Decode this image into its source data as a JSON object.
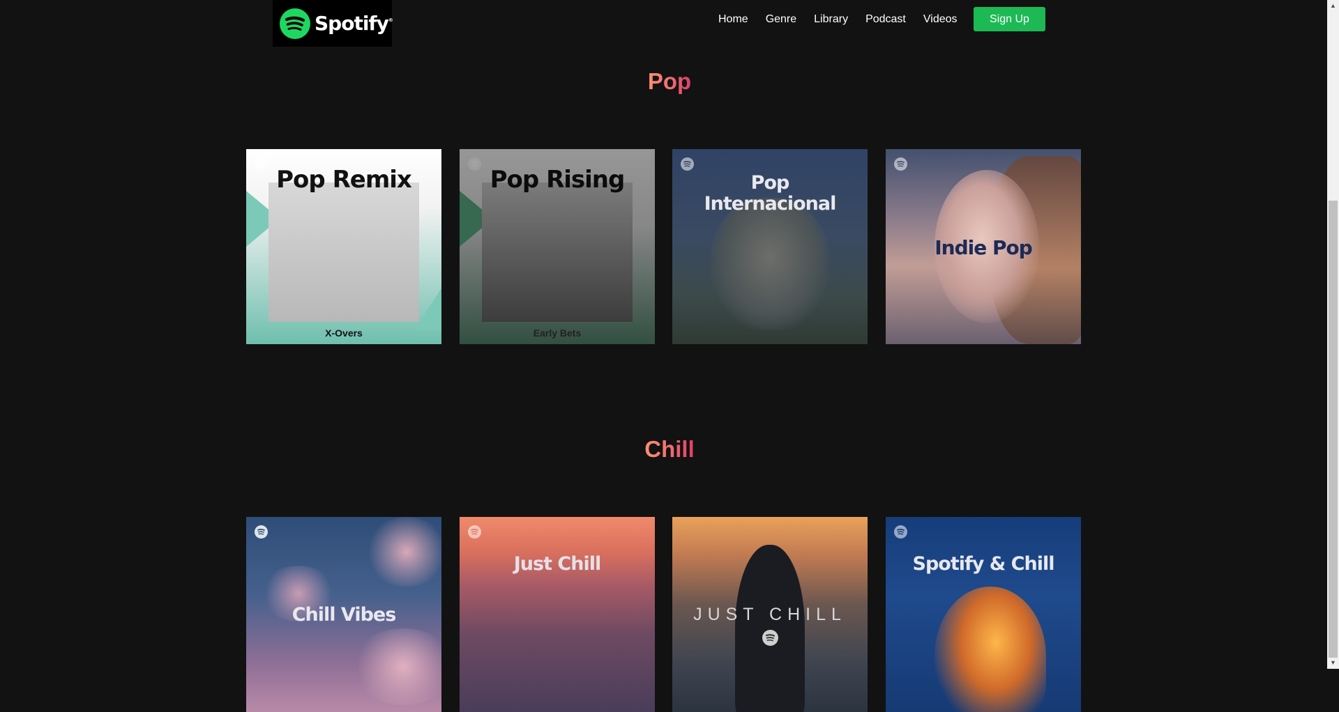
{
  "brand": {
    "name": "Spotify",
    "reg_mark": "®"
  },
  "nav": {
    "items": [
      "Home",
      "Genre",
      "Library",
      "Podcast",
      "Videos"
    ],
    "signup_label": "Sign Up"
  },
  "colors": {
    "brand_green": "#1db954",
    "background": "#121212",
    "title_gradient": [
      "#ff9070",
      "#dd3d6a"
    ]
  },
  "sections": [
    {
      "title": "Pop",
      "playlists": [
        {
          "title": "Pop Remix",
          "subtitle": "X-Overs"
        },
        {
          "title": "Pop Rising",
          "subtitle": "Early Bets"
        },
        {
          "title_line1": "Pop",
          "title_line2": "Internacional"
        },
        {
          "title": "Indie Pop"
        }
      ]
    },
    {
      "title": "Chill",
      "playlists": [
        {
          "title": "Chill Vibes"
        },
        {
          "title": "Just Chill"
        },
        {
          "title": "JUST CHILL"
        },
        {
          "title": "Spotify & Chill"
        }
      ]
    }
  ],
  "icons": {
    "card_badge": "spotify-icon",
    "logo": "spotify-logo-icon"
  }
}
